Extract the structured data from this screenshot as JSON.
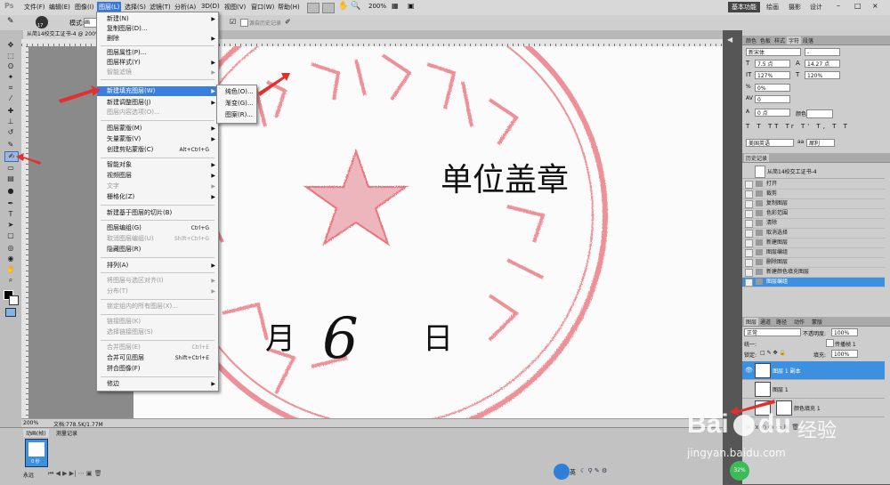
{
  "menubar": {
    "logo": "Ps",
    "items": [
      "文件(F)",
      "编辑(E)",
      "图像(I)",
      "图层(L)",
      "选择(S)",
      "滤镜(T)",
      "分析(A)",
      "3D(D)",
      "视图(V)",
      "窗口(W)",
      "帮助(H)"
    ],
    "zoom": "200%",
    "workspaces": [
      "基本功能",
      "绘画",
      "摄影",
      "设计"
    ],
    "window_controls": [
      "–",
      "□",
      "×"
    ]
  },
  "optbar": {
    "mode_label": "模式:",
    "mode_value": "画",
    "brush_size": "17",
    "history_label": "源自历史记录"
  },
  "document": {
    "tab_title": "从简14校交工证书-4 @ 200%",
    "stamp_text": "单位盖章",
    "date_month": "月",
    "date_day_number": "6",
    "date_day": "日"
  },
  "statusbar": {
    "zoom": "200%",
    "doc_info": "文档:778.5K/1.77M"
  },
  "animpanel": {
    "tabs": [
      "动画(帧)",
      "测量记录"
    ],
    "frame_time": "0 秒",
    "loop": "永远"
  },
  "layer_menu": {
    "items": [
      {
        "label": "新建(N)",
        "shortcut": "",
        "arrow": true,
        "disabled": false
      },
      {
        "label": "复制图层(D)...",
        "shortcut": "",
        "arrow": false,
        "disabled": false
      },
      {
        "label": "删除",
        "shortcut": "",
        "arrow": true,
        "disabled": false
      },
      {
        "label": "图层属性(P)...",
        "shortcut": "",
        "arrow": false,
        "disabled": false
      },
      {
        "label": "图层样式(Y)",
        "shortcut": "",
        "arrow": true,
        "disabled": false
      },
      {
        "label": "智能滤镜",
        "shortcut": "",
        "arrow": true,
        "disabled": true
      },
      {
        "label": "新建填充图层(W)",
        "shortcut": "",
        "arrow": true,
        "disabled": false
      },
      {
        "label": "新建调整图层(J)",
        "shortcut": "",
        "arrow": true,
        "disabled": false
      },
      {
        "label": "图层内容选项(O)...",
        "shortcut": "",
        "arrow": false,
        "disabled": true
      },
      {
        "label": "图层蒙版(M)",
        "shortcut": "",
        "arrow": true,
        "disabled": false
      },
      {
        "label": "矢量蒙版(V)",
        "shortcut": "",
        "arrow": true,
        "disabled": false
      },
      {
        "label": "创建剪贴蒙版(C)",
        "shortcut": "Alt+Ctrl+G",
        "arrow": false,
        "disabled": false
      },
      {
        "label": "智能对象",
        "shortcut": "",
        "arrow": true,
        "disabled": false
      },
      {
        "label": "视频图层",
        "shortcut": "",
        "arrow": true,
        "disabled": false
      },
      {
        "label": "文字",
        "shortcut": "",
        "arrow": true,
        "disabled": true
      },
      {
        "label": "栅格化(Z)",
        "shortcut": "",
        "arrow": true,
        "disabled": false
      },
      {
        "label": "新建基于图层的切片(B)",
        "shortcut": "",
        "arrow": false,
        "disabled": false
      },
      {
        "label": "图层编组(G)",
        "shortcut": "Ctrl+G",
        "arrow": false,
        "disabled": false
      },
      {
        "label": "取消图层编组(U)",
        "shortcut": "Shift+Ctrl+G",
        "arrow": false,
        "disabled": true
      },
      {
        "label": "隐藏图层(R)",
        "shortcut": "",
        "arrow": false,
        "disabled": false
      },
      {
        "label": "排列(A)",
        "shortcut": "",
        "arrow": true,
        "disabled": false
      },
      {
        "label": "将图层与选区对齐(I)",
        "shortcut": "",
        "arrow": true,
        "disabled": true
      },
      {
        "label": "分布(T)",
        "shortcut": "",
        "arrow": true,
        "disabled": true
      },
      {
        "label": "锁定组内的所有图层(X)...",
        "shortcut": "",
        "arrow": false,
        "disabled": true
      },
      {
        "label": "链接图层(K)",
        "shortcut": "",
        "arrow": false,
        "disabled": true
      },
      {
        "label": "选择链接图层(S)",
        "shortcut": "",
        "arrow": false,
        "disabled": true
      },
      {
        "label": "合并图层(E)",
        "shortcut": "Ctrl+E",
        "arrow": false,
        "disabled": true
      },
      {
        "label": "合并可见图层",
        "shortcut": "Shift+Ctrl+E",
        "arrow": false,
        "disabled": false
      },
      {
        "label": "拼合图像(F)",
        "shortcut": "",
        "arrow": false,
        "disabled": false
      },
      {
        "label": "修边",
        "shortcut": "",
        "arrow": true,
        "disabled": false
      }
    ],
    "highlighted": "新建填充图层(W)"
  },
  "fill_submenu": {
    "items": [
      "纯色(O)...",
      "渐变(G)...",
      "图案(R)..."
    ]
  },
  "char_panel": {
    "tabs": [
      "颜色",
      "色板",
      "样式",
      "字符",
      "段落"
    ],
    "font": "新宋体",
    "font_style": "-",
    "size": "7.5 点",
    "leading": "14.27 点",
    "vscale": "127%",
    "hscale": "120%",
    "tracking": "0%",
    "kerning": "0",
    "baseline": "0 点",
    "color_label": "颜色:",
    "language": "美国英语",
    "aa_prefix": "aa",
    "antialias": "犀利"
  },
  "history_panel": {
    "tab": "历史记录",
    "snapshot": "从简14校交工证书-4",
    "items": [
      "打开",
      "裁剪",
      "复制图层",
      "色彩范围",
      "清除",
      "取消选择",
      "新建图层",
      "图层编组",
      "删除图层",
      "新建颜色填充图层",
      "图层编组"
    ]
  },
  "layers_panel": {
    "tabs": [
      "图层",
      "通道",
      "路径",
      "动作",
      "蒙版"
    ],
    "blend": "正常",
    "opacity_label": "不透明度:",
    "opacity": "100%",
    "lock_label": "锁定:",
    "fill_label": "填充:",
    "fill": "100%",
    "propagate_label": "传播帧 1",
    "unify_label": "统一:",
    "layers": [
      "图层 1 副本",
      "图层 1",
      "颜色填充 1"
    ]
  },
  "taskbar": {
    "ime": "英",
    "cpu": "32%"
  },
  "watermark": {
    "brand": "Bai",
    "brand2": "du",
    "jingyan": "经验",
    "url": "jingyan.baidu.com"
  },
  "colors": {
    "highlight": "#3a7ee0",
    "stamp_red": "#e03a4a"
  }
}
